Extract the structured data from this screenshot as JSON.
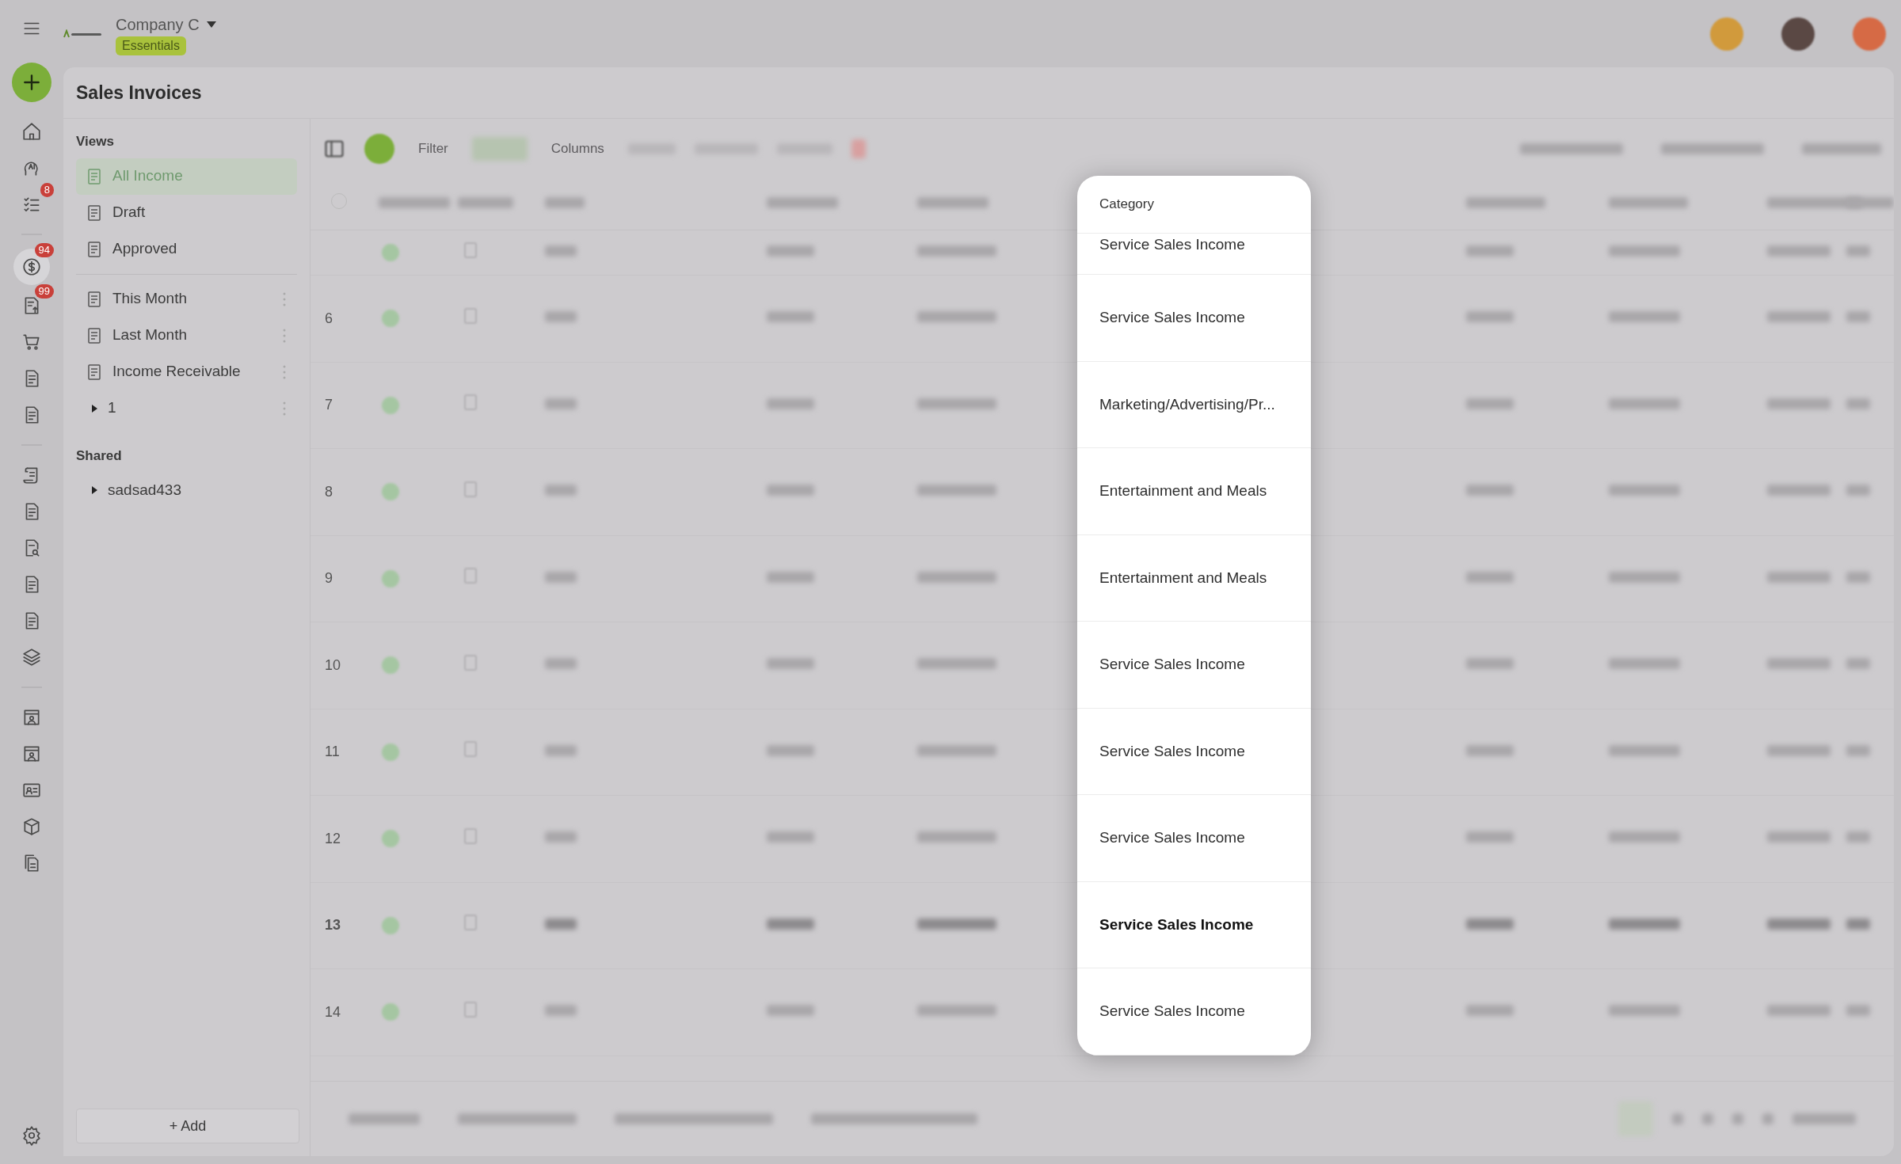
{
  "app": {
    "company": "Company C",
    "plan": "Essentials"
  },
  "rail": {
    "items": [
      {
        "kind": "home",
        "selected": false
      },
      {
        "kind": "ai",
        "selected": false
      },
      {
        "kind": "checklist",
        "selected": false,
        "badge": "8"
      },
      {
        "kind": "divider"
      },
      {
        "kind": "dollar",
        "selected": true,
        "badge": "94"
      },
      {
        "kind": "invoice",
        "selected": false,
        "badge": "99"
      },
      {
        "kind": "cart",
        "selected": false
      },
      {
        "kind": "doc",
        "selected": false
      },
      {
        "kind": "doc",
        "selected": false
      },
      {
        "kind": "divider"
      },
      {
        "kind": "scroll",
        "selected": false
      },
      {
        "kind": "doc",
        "selected": false
      },
      {
        "kind": "search-doc",
        "selected": false
      },
      {
        "kind": "doc",
        "selected": false
      },
      {
        "kind": "doc",
        "selected": false
      },
      {
        "kind": "layers",
        "selected": false
      },
      {
        "kind": "divider"
      },
      {
        "kind": "store",
        "selected": false
      },
      {
        "kind": "store",
        "selected": false
      },
      {
        "kind": "contact",
        "selected": false
      },
      {
        "kind": "box",
        "selected": false
      },
      {
        "kind": "docs",
        "selected": false
      }
    ]
  },
  "page": {
    "title": "Sales Invoices"
  },
  "sidebar": {
    "sections": [
      {
        "title": "Views",
        "items": [
          {
            "kind": "view",
            "label": "All Income",
            "selected": true,
            "menu": false
          },
          {
            "kind": "view",
            "label": "Draft",
            "selected": false,
            "menu": false
          },
          {
            "kind": "view",
            "label": "Approved",
            "selected": false,
            "menu": false
          },
          {
            "kind": "divider"
          },
          {
            "kind": "view",
            "label": "This Month",
            "selected": false,
            "menu": true
          },
          {
            "kind": "view",
            "label": "Last Month",
            "selected": false,
            "menu": true
          },
          {
            "kind": "view",
            "label": "Income Receivable",
            "selected": false,
            "menu": true
          },
          {
            "kind": "folder",
            "label": "1",
            "selected": false,
            "menu": true,
            "expanded": false
          }
        ]
      },
      {
        "title": "Shared",
        "items": [
          {
            "kind": "folder",
            "label": "sadsad433",
            "selected": false,
            "menu": false,
            "expanded": false
          }
        ]
      }
    ],
    "add_button": "+ Add"
  },
  "toolbar": {
    "filter": "Filter",
    "columns": "Columns"
  },
  "table": {
    "select_all_checked": false,
    "category_header": "Category",
    "rows": [
      {
        "category": "Service Sales Income",
        "highlighted": false
      },
      {
        "number": "6",
        "category": "Service Sales Income",
        "highlighted": false
      },
      {
        "number": "7",
        "category": "Marketing/Advertising/Pr...",
        "highlighted": false
      },
      {
        "number": "8",
        "category": "Entertainment and Meals",
        "highlighted": false
      },
      {
        "number": "9",
        "category": "Entertainment and Meals",
        "highlighted": false
      },
      {
        "number": "10",
        "category": "Service Sales Income",
        "highlighted": false
      },
      {
        "number": "11",
        "category": "Service Sales Income",
        "highlighted": false
      },
      {
        "number": "12",
        "category": "Service Sales Income",
        "highlighted": false
      },
      {
        "number": "13",
        "category": "Service Sales Income",
        "highlighted": true
      },
      {
        "number": "14",
        "category": "Service Sales Income",
        "highlighted": false
      }
    ]
  }
}
